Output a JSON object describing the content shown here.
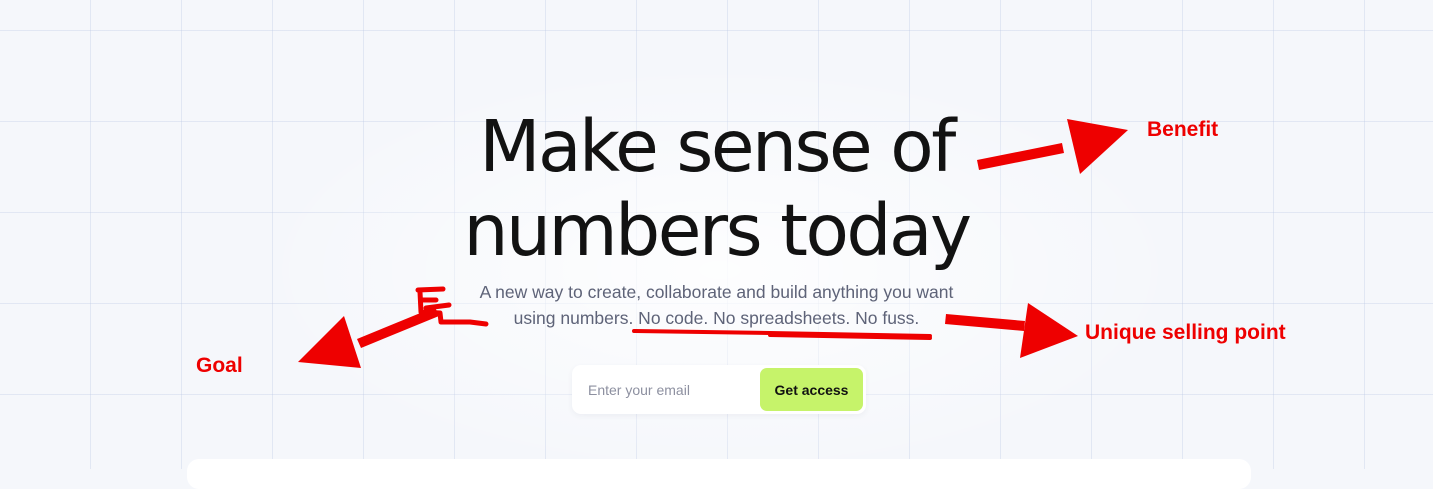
{
  "hero": {
    "headline_line1": "Make sense of",
    "headline_line2": "numbers today",
    "subtitle_line1": "A new way to create, collaborate and build anything you want",
    "subtitle_line2": "using numbers. No code. No spreadsheets. No fuss."
  },
  "signup": {
    "email_placeholder": "Enter your email",
    "button_label": "Get access"
  },
  "annotations": {
    "benefit": "Benefit",
    "unique_selling_point": "Unique selling point",
    "goal": "Goal"
  },
  "colors": {
    "page_background": "#f5f7fb",
    "headline_text": "#121212",
    "subtitle_text": "#5e6378",
    "button_background": "#c6f36a",
    "annotation_red": "#ee0000"
  }
}
